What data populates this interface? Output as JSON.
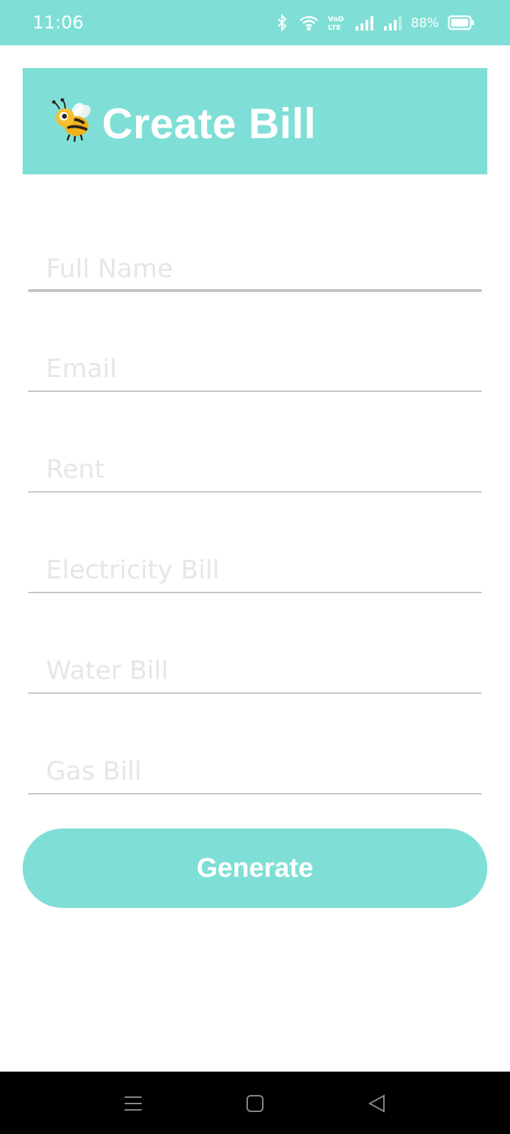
{
  "status_bar": {
    "time": "11:06",
    "battery_percent": "88%",
    "volte_label": "VoD LTE2",
    "icons": [
      "bluetooth-icon",
      "wifi-icon",
      "volte-icon",
      "signal-icon",
      "signal-icon",
      "battery-icon"
    ]
  },
  "header": {
    "title": "Create Bill",
    "logo_icon": "bee-icon",
    "background_color": "#7fdfd6"
  },
  "form": {
    "fields": [
      {
        "placeholder": "Full Name",
        "value": ""
      },
      {
        "placeholder": "Email",
        "value": ""
      },
      {
        "placeholder": "Rent",
        "value": ""
      },
      {
        "placeholder": "Electricity Bill",
        "value": ""
      },
      {
        "placeholder": "Water Bill",
        "value": ""
      },
      {
        "placeholder": "Gas Bill",
        "value": ""
      }
    ],
    "submit_label": "Generate"
  },
  "nav_bar": {
    "icons": [
      "menu-icon",
      "home-icon",
      "back-icon"
    ]
  },
  "colors": {
    "accent": "#7fdfd6",
    "placeholder": "#e6e6ea",
    "underline": "#c4c4c8"
  }
}
